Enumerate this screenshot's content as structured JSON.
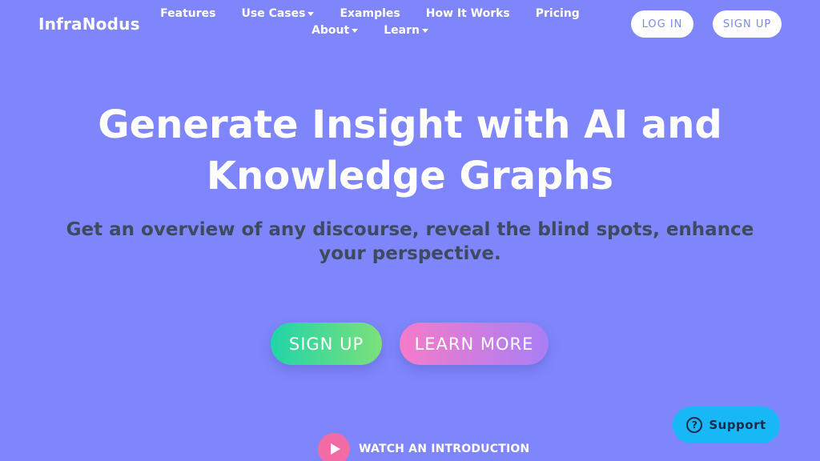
{
  "header": {
    "brand": "InfraNodus",
    "nav": [
      {
        "label": "Features",
        "dropdown": false
      },
      {
        "label": "Use Cases",
        "dropdown": true
      },
      {
        "label": "Examples",
        "dropdown": false
      },
      {
        "label": "How It Works",
        "dropdown": false
      },
      {
        "label": "Pricing",
        "dropdown": false
      },
      {
        "label": "About",
        "dropdown": true
      },
      {
        "label": "Learn",
        "dropdown": true
      }
    ],
    "login_label": "LOG IN",
    "signup_label": "SIGN UP"
  },
  "hero": {
    "title_line1": "Generate Insight with AI and",
    "title_line2": "Knowledge Graphs",
    "subtitle": "Get an overview of any discourse, reveal the blind spots, enhance your perspective.",
    "cta_signup": "SIGN UP",
    "cta_learn": "LEARN MORE",
    "watch_label": "WATCH AN INTRODUCTION"
  },
  "support": {
    "label": "Support",
    "icon": "question-icon"
  },
  "colors": {
    "background": "#7f86fb",
    "subtitle": "#3e4a60",
    "cta_signup_gradient": [
      "#21d4a8",
      "#7ce07a"
    ],
    "cta_learn_gradient": [
      "#f57bc9",
      "#a97ef5"
    ],
    "play": "#f26ba4",
    "support": "#18b8f6"
  }
}
